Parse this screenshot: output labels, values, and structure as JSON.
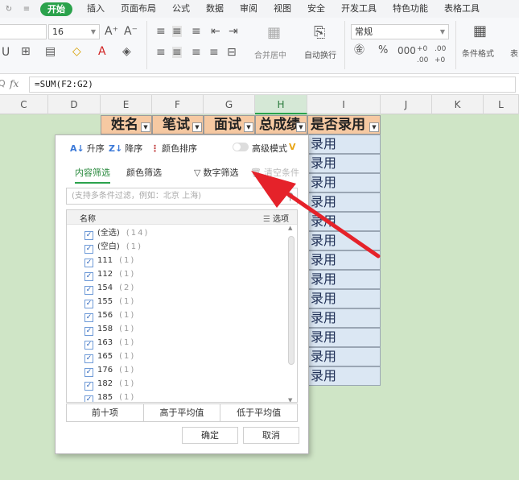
{
  "menu": {
    "quick_access": [
      "↻",
      "≡"
    ],
    "tabs": [
      "开始",
      "插入",
      "页面布局",
      "公式",
      "数据",
      "审阅",
      "视图",
      "安全",
      "开发工具",
      "特色功能",
      "表格工具"
    ]
  },
  "ribbon": {
    "font_size": "16",
    "merge_label": "合并居中",
    "wrap_label": "自动换行",
    "number_format": "常规",
    "conditional_format_label": "条件格式",
    "table_label": "表"
  },
  "formula_bar": {
    "fx_label": "fx",
    "formula": "=SUM(F2:G2)"
  },
  "columns": [
    "C",
    "D",
    "E",
    "F",
    "G",
    "H",
    "I",
    "J",
    "K",
    "L"
  ],
  "sheet": {
    "headers": [
      "姓名",
      "笔试",
      "面试",
      "总成绩",
      "是否录用"
    ],
    "column_i_values": [
      "录用",
      "录用",
      "录用",
      "录用",
      "录用",
      "录用",
      "录用",
      "录用",
      "录用",
      "录用",
      "录用",
      "录用",
      "录用"
    ]
  },
  "filter_popup": {
    "sort": {
      "asc": "升序",
      "desc": "降序",
      "color": "颜色排序",
      "advanced": "高级模式",
      "vip": "V"
    },
    "tabs": {
      "content": "内容筛选",
      "color": "颜色筛选",
      "number": "数字筛选",
      "clear": "清空条件"
    },
    "search_placeholder": "(支持多条件过滤，例如：北京 上海)",
    "list_header": {
      "name": "名称",
      "options": "选项"
    },
    "items": [
      {
        "label": "(全选)",
        "count": "(14)"
      },
      {
        "label": "(空白)",
        "count": "(1)"
      },
      {
        "label": "111",
        "count": "(1)"
      },
      {
        "label": "112",
        "count": "(1)"
      },
      {
        "label": "154",
        "count": "(2)"
      },
      {
        "label": "155",
        "count": "(1)"
      },
      {
        "label": "156",
        "count": "(1)"
      },
      {
        "label": "158",
        "count": "(1)"
      },
      {
        "label": "163",
        "count": "(1)"
      },
      {
        "label": "165",
        "count": "(1)"
      },
      {
        "label": "176",
        "count": "(1)"
      },
      {
        "label": "182",
        "count": "(1)"
      },
      {
        "label": "185",
        "count": "(1)"
      }
    ],
    "quick_buttons": [
      "前十项",
      "高于平均值",
      "低于平均值"
    ],
    "ok": "确定",
    "cancel": "取消"
  },
  "colors": {
    "accent_green": "#2ba24c",
    "header_fill": "#f6c9a2",
    "cell_fill": "#dbe7f3",
    "arrow_red": "#e5222a"
  }
}
